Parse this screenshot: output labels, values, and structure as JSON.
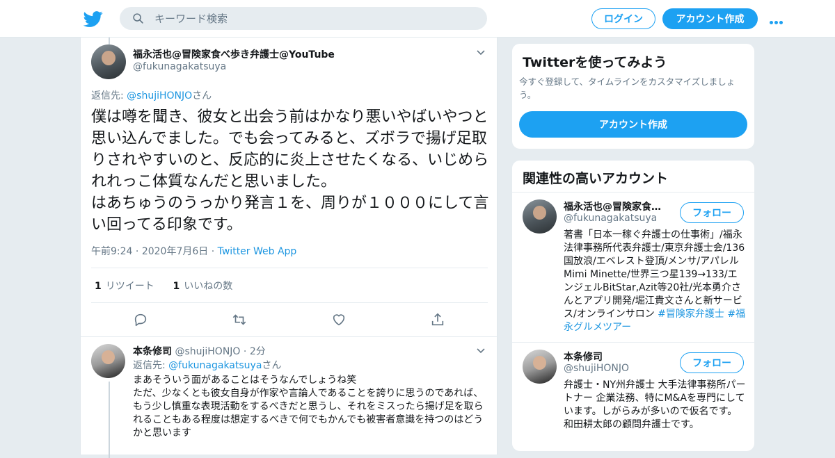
{
  "header": {
    "search_placeholder": "キーワード検索",
    "login_label": "ログイン",
    "signup_label": "アカウント作成"
  },
  "tweet": {
    "author_name": "福永活也@冒険家食べ歩き弁護士@YouTube",
    "author_handle": "@fukunagakatsuya",
    "reply_prefix": "返信先: ",
    "reply_to": "@shujiHONJO",
    "reply_suffix": "さん",
    "text": "僕は噂を聞き、彼女と出会う前はかなり悪いやばいやつと思い込んでました。でも会ってみると、ズボラで揚げ足取りされやすいのと、反応的に炎上させたくなる、いじめられれっこ体質なんだと思いました。\nはあちゅうのうっかり発言１を、周りが１０００にして言い回ってる印象です。",
    "time": "午前9:24",
    "date": "2020年7月6日",
    "source": "Twitter Web App",
    "retweet_count": "1",
    "retweet_label": "リツイート",
    "like_count": "1",
    "like_label": "いいねの数"
  },
  "reply": {
    "author_name": "本条修司",
    "author_handle": "@shujiHONJO",
    "time_ago": "2分",
    "reply_prefix": "返信先: ",
    "reply_to": "@fukunagakatsuya",
    "reply_suffix": "さん",
    "text": "まあそういう面があることはそうなんでしょうね笑\nただ、少なくとも彼女自身が作家や言論人であることを誇りに思うのであれば、もう少し慎重な表現活動をするべきだと思うし、それをミスったら揚げ足を取られることもある程度は想定するべきで何でもかんでも被害者意識を持つのはどうかと思います"
  },
  "sidebar": {
    "signup_card": {
      "title": "Twitterを使ってみよう",
      "subtitle": "今すぐ登録して、タイムラインをカスタマイズしましょう。",
      "button_label": "アカウント作成"
    },
    "related": {
      "title": "関連性の高いアカウント",
      "follow_label": "フォロー",
      "accounts": [
        {
          "name": "福永活也@冒険家食…",
          "handle": "@fukunagakatsuya",
          "bio": "著書「日本一稼ぐ弁護士の仕事術」/福永法律事務所代表弁護士/東京弁護士会/136国放浪/エベレスト登頂/メンサ/アパレルMimi Minette/世界三つ星139→133/エンジェルBitStar,Azit等20社/光本勇介さんとアプリ開発/堀江貴文さんと新サービス/オンラインサロン",
          "hashtags": "#冒険家弁護士 #福永グルメツアー"
        },
        {
          "name": "本条修司",
          "handle": "@shujiHONJO",
          "bio": "弁護士・NY州弁護士 大手法律事務所パートナー 企業法務、特にM&Aを専門にしています。しがらみが多いので仮名です。和田耕太郎の顧問弁護士です。"
        }
      ]
    }
  }
}
